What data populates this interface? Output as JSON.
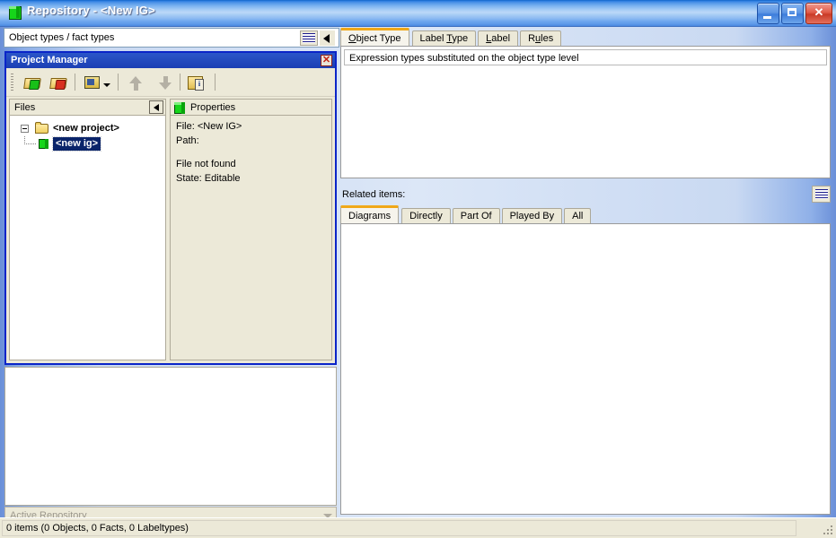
{
  "window": {
    "title": "Repository - <New IG>",
    "icon": "green-cube-icon",
    "minimize_label": "_",
    "maximize_label": "□",
    "close_label": "✕"
  },
  "left": {
    "type_combo": {
      "value": "Object types / fact types",
      "grid_icon": "grid-view-icon",
      "collapse_icon": "triangle-left-icon"
    },
    "project_manager": {
      "title": "Project Manager",
      "close_label": "✕",
      "toolbar": [
        {
          "name": "add-project-button",
          "icon": "folder-open-add-icon"
        },
        {
          "name": "remove-project-button",
          "icon": "folder-open-remove-icon"
        },
        {
          "name": "repository-button",
          "icon": "repository-monitor-icon"
        },
        {
          "name": "move-up-button",
          "icon": "arrow-up-icon"
        },
        {
          "name": "move-down-button",
          "icon": "arrow-down-icon"
        },
        {
          "name": "project-info-button",
          "icon": "folder-info-icon"
        }
      ],
      "files_panel": {
        "header": "Files",
        "collapse_icon": "triangle-left-icon",
        "tree": {
          "root_label": "<new project>",
          "child_label": "<new ig>"
        }
      },
      "properties_panel": {
        "header": "Properties",
        "header_icon": "green-cube-icon",
        "lines": [
          "File: <New IG>",
          "Path:",
          "",
          "File not found",
          "State: Editable"
        ]
      }
    },
    "active_repository_combo": {
      "value": "Active Repository"
    }
  },
  "right": {
    "tabs": [
      {
        "label": "Object Type",
        "accel": "O",
        "active": true
      },
      {
        "label": "Label Type",
        "accel": "T",
        "active": false
      },
      {
        "label": "Label",
        "accel": "L",
        "active": false
      },
      {
        "label": "Rules",
        "accel": "u",
        "active": false
      }
    ],
    "expression_text": "Expression types substituted on the object type level",
    "related_items_label": "Related items:",
    "related_grid_icon": "grid-view-icon",
    "related_tabs": [
      {
        "label": "Diagrams",
        "active": true
      },
      {
        "label": "Directly",
        "active": false
      },
      {
        "label": "Part Of",
        "active": false
      },
      {
        "label": "Played By",
        "active": false
      },
      {
        "label": "All",
        "active": false
      }
    ]
  },
  "status": {
    "text": "0 items (0 Objects, 0 Facts, 0 Labeltypes)"
  },
  "colors": {
    "titlebar_blue": "#3d7fd8",
    "accent_orange": "#f0a818",
    "panel_beige": "#ece9d8",
    "pm_border_blue": "#0a24c8",
    "selection_blue": "#0a246a",
    "cube_green": "#16d61a"
  }
}
